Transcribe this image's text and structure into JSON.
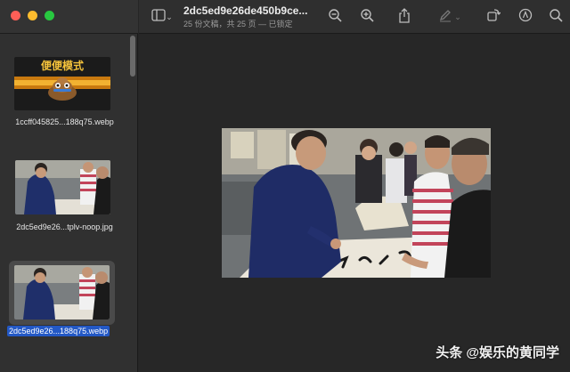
{
  "window": {
    "title": "2dc5ed9e26de450b9ce...",
    "subtitle": "25 份文稿，共 25 页 — 已锁定"
  },
  "sidebar": {
    "thumbnails": [
      {
        "label": "1ccff045825...188q75.webp",
        "sticker_text": "便便模式",
        "selected": false
      },
      {
        "label": "2dc5ed9e26...tplv-noop.jpg",
        "selected": false
      },
      {
        "label": "2dc5ed9e26...188q75.webp",
        "selected": true
      }
    ]
  },
  "toolbar": {
    "icons": [
      "sidebar-icon",
      "chevron-down-icon",
      "zoom-out-icon",
      "zoom-in-icon",
      "share-icon",
      "markup-pen-icon",
      "chevron-down-icon",
      "rotate-icon",
      "annotate-icon",
      "search-icon"
    ]
  },
  "watermark": "头条 @娱乐的黄同学",
  "colors": {
    "accent": "#2358c5",
    "sidebar": "#303030",
    "canvas": "#272727"
  }
}
